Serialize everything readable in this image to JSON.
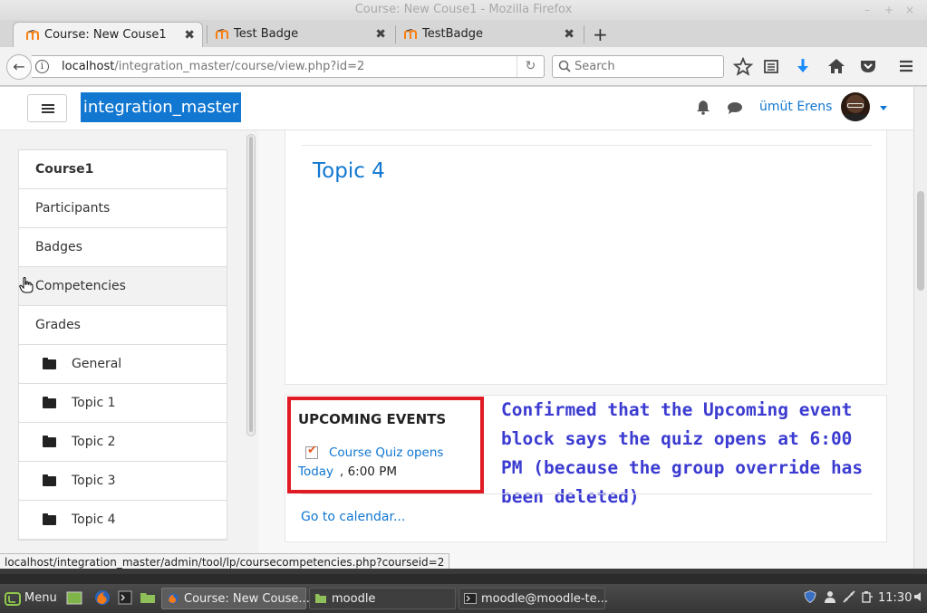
{
  "window": {
    "title": "Course: New Couse1 - Mozilla Firefox",
    "controls": [
      "–",
      "+",
      "×"
    ]
  },
  "tabs": [
    {
      "label": "Course: New Couse1",
      "active": true
    },
    {
      "label": "Test Badge",
      "active": false
    },
    {
      "label": "TestBadge",
      "active": false
    }
  ],
  "new_tab": "+",
  "tab_close": "✖",
  "navbar": {
    "back": "←",
    "info": "i",
    "url_host": "localhost",
    "url_path": "/integration_master/course/view.php?id=2",
    "reload": "↻",
    "search_placeholder": "Search",
    "icons": [
      "star-icon",
      "reading-list-icon",
      "download-icon",
      "home-icon",
      "pocket-icon",
      "menu-icon"
    ]
  },
  "site": {
    "name": "integration_master",
    "user_name": "ümüt Erens"
  },
  "drawer": {
    "items": [
      {
        "label": "Course1",
        "bold": true
      },
      {
        "label": "Participants"
      },
      {
        "label": "Badges"
      },
      {
        "label": "Competencies",
        "hover": true
      },
      {
        "label": "Grades"
      },
      {
        "label": "General",
        "folder": true
      },
      {
        "label": "Topic 1",
        "folder": true
      },
      {
        "label": "Topic 2",
        "folder": true
      },
      {
        "label": "Topic 3",
        "folder": true
      },
      {
        "label": "Topic 4",
        "folder": true
      }
    ]
  },
  "main": {
    "topic_title": "Topic 4",
    "upcoming_events": {
      "heading": "UPCOMING EVENTS",
      "event_link": "Course Quiz opens",
      "event_day": "Today",
      "event_time": ", 6:00 PM",
      "go_to_calendar": "Go to calendar..."
    },
    "annotation": "Confirmed that the Upcoming event block says the quiz opens at 6:00 PM (because the group override has been deleted)"
  },
  "status_url": "localhost/integration_master/admin/tool/lp/coursecompetencies.php?courseid=2",
  "taskbar": {
    "menu_label": "Menu",
    "windows": [
      {
        "label": "Course: New Couse...",
        "active": true
      },
      {
        "label": "moodle",
        "active": false
      },
      {
        "label": "moodle@moodle-te...",
        "active": false
      }
    ],
    "clock": "11:30"
  },
  "colors": {
    "moodle_blue": "#1177d1",
    "annotation": "#3b3bd1",
    "highlight_box": "#e01b24"
  }
}
